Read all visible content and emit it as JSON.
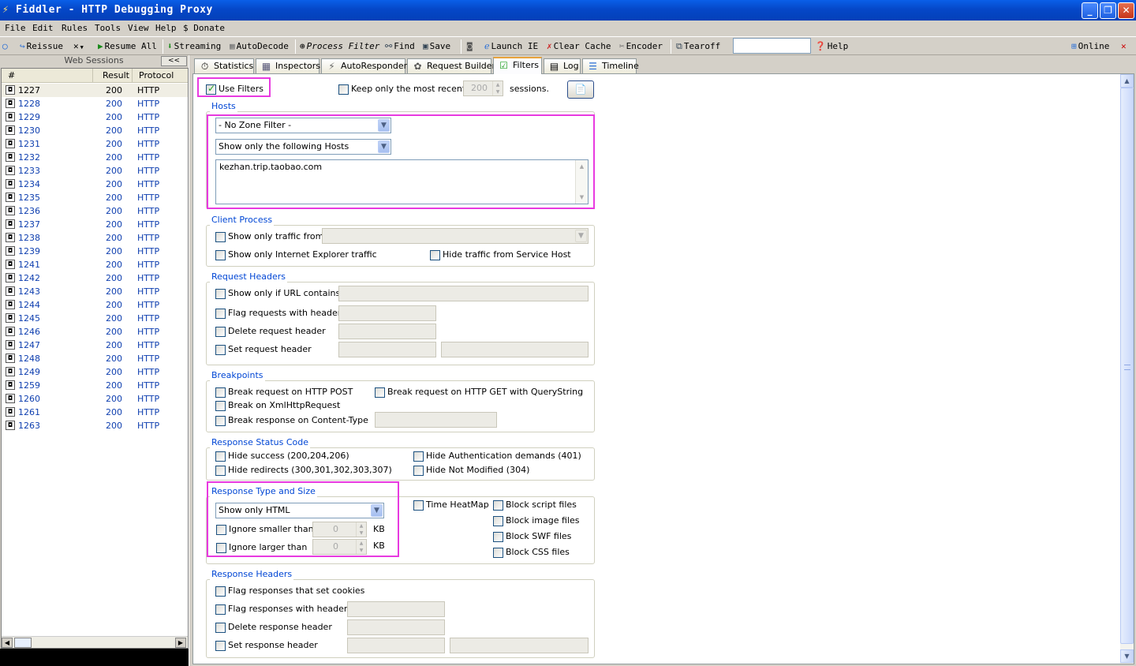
{
  "window": {
    "title": "Fiddler - HTTP Debugging Proxy"
  },
  "menu": [
    "File",
    "Edit",
    "Rules",
    "Tools",
    "View",
    "Help",
    "$ Donate"
  ],
  "toolbar": {
    "reissue": "Reissue",
    "resume_all": "Resume All",
    "streaming": "Streaming",
    "autodecode": "AutoDecode",
    "process_filter": "Process Filter",
    "find": "Find",
    "save": "Save",
    "launch_ie": "Launch IE",
    "clear_cache": "Clear Cache",
    "encoder": "Encoder",
    "tearoff": "Tearoff",
    "help": "Help",
    "online": "Online"
  },
  "sessions": {
    "title": "Web Sessions",
    "collapse": "<<",
    "columns": {
      "num": "#",
      "result": "Result",
      "protocol": "Protocol"
    },
    "rows": [
      {
        "num": "1227",
        "result": "200",
        "protocol": "HTTP"
      },
      {
        "num": "1228",
        "result": "200",
        "protocol": "HTTP"
      },
      {
        "num": "1229",
        "result": "200",
        "protocol": "HTTP"
      },
      {
        "num": "1230",
        "result": "200",
        "protocol": "HTTP"
      },
      {
        "num": "1231",
        "result": "200",
        "protocol": "HTTP"
      },
      {
        "num": "1232",
        "result": "200",
        "protocol": "HTTP"
      },
      {
        "num": "1233",
        "result": "200",
        "protocol": "HTTP"
      },
      {
        "num": "1234",
        "result": "200",
        "protocol": "HTTP"
      },
      {
        "num": "1235",
        "result": "200",
        "protocol": "HTTP"
      },
      {
        "num": "1236",
        "result": "200",
        "protocol": "HTTP"
      },
      {
        "num": "1237",
        "result": "200",
        "protocol": "HTTP"
      },
      {
        "num": "1238",
        "result": "200",
        "protocol": "HTTP"
      },
      {
        "num": "1239",
        "result": "200",
        "protocol": "HTTP"
      },
      {
        "num": "1241",
        "result": "200",
        "protocol": "HTTP"
      },
      {
        "num": "1242",
        "result": "200",
        "protocol": "HTTP"
      },
      {
        "num": "1243",
        "result": "200",
        "protocol": "HTTP"
      },
      {
        "num": "1244",
        "result": "200",
        "protocol": "HTTP"
      },
      {
        "num": "1245",
        "result": "200",
        "protocol": "HTTP"
      },
      {
        "num": "1246",
        "result": "200",
        "protocol": "HTTP"
      },
      {
        "num": "1247",
        "result": "200",
        "protocol": "HTTP"
      },
      {
        "num": "1248",
        "result": "200",
        "protocol": "HTTP"
      },
      {
        "num": "1249",
        "result": "200",
        "protocol": "HTTP"
      },
      {
        "num": "1259",
        "result": "200",
        "protocol": "HTTP"
      },
      {
        "num": "1260",
        "result": "200",
        "protocol": "HTTP"
      },
      {
        "num": "1261",
        "result": "200",
        "protocol": "HTTP"
      },
      {
        "num": "1263",
        "result": "200",
        "protocol": "HTTP"
      }
    ]
  },
  "tabs": [
    "Statistics",
    "Inspectors",
    "AutoResponder",
    "Request Builder",
    "Filters",
    "Log",
    "Timeline"
  ],
  "filters": {
    "use_filters": "Use Filters",
    "keep_recent": "Keep only the most recent",
    "recent_count": "200",
    "sessions_label": "sessions.",
    "hosts": {
      "title": "Hosts",
      "zone": "- No Zone Filter -",
      "mode": "Show only the following Hosts",
      "list": "kezhan.trip.taobao.com"
    },
    "client": {
      "title": "Client Process",
      "traffic_from": "Show only traffic from",
      "ie_only": "Show only Internet Explorer traffic",
      "hide_service": "Hide traffic from Service Host"
    },
    "req_headers": {
      "title": "Request Headers",
      "url_contains": "Show only if URL contains",
      "flag_header": "Flag requests with header",
      "delete_header": "Delete request header",
      "set_header": "Set request header"
    },
    "breakpoints": {
      "title": "Breakpoints",
      "post": "Break request on HTTP POST",
      "get_qs": "Break request on HTTP GET with QueryString",
      "xhr": "Break on XmlHttpRequest",
      "content_type": "Break response on Content-Type"
    },
    "status": {
      "title": "Response Status Code",
      "success": "Hide success (200,204,206)",
      "auth": "Hide Authentication demands (401)",
      "redirects": "Hide redirects (300,301,302,303,307)",
      "not_modified": "Hide Not Modified (304)"
    },
    "type_size": {
      "title": "Response Type and Size",
      "type": "Show only HTML",
      "smaller": "Ignore smaller than",
      "larger": "Ignore larger than",
      "smaller_val": "0",
      "larger_val": "0",
      "unit": "KB",
      "heatmap": "Time HeatMap",
      "block_script": "Block script files",
      "block_image": "Block image files",
      "block_swf": "Block SWF files",
      "block_css": "Block CSS files"
    },
    "resp_headers": {
      "title": "Response Headers",
      "cookies": "Flag responses that set cookies",
      "flag_header": "Flag responses with header",
      "delete_header": "Delete response header",
      "set_header": "Set response header"
    }
  },
  "colors": {
    "highlight": "#e83ae0",
    "title_blue": "#0046d5",
    "titlebar": "#0547c8"
  }
}
